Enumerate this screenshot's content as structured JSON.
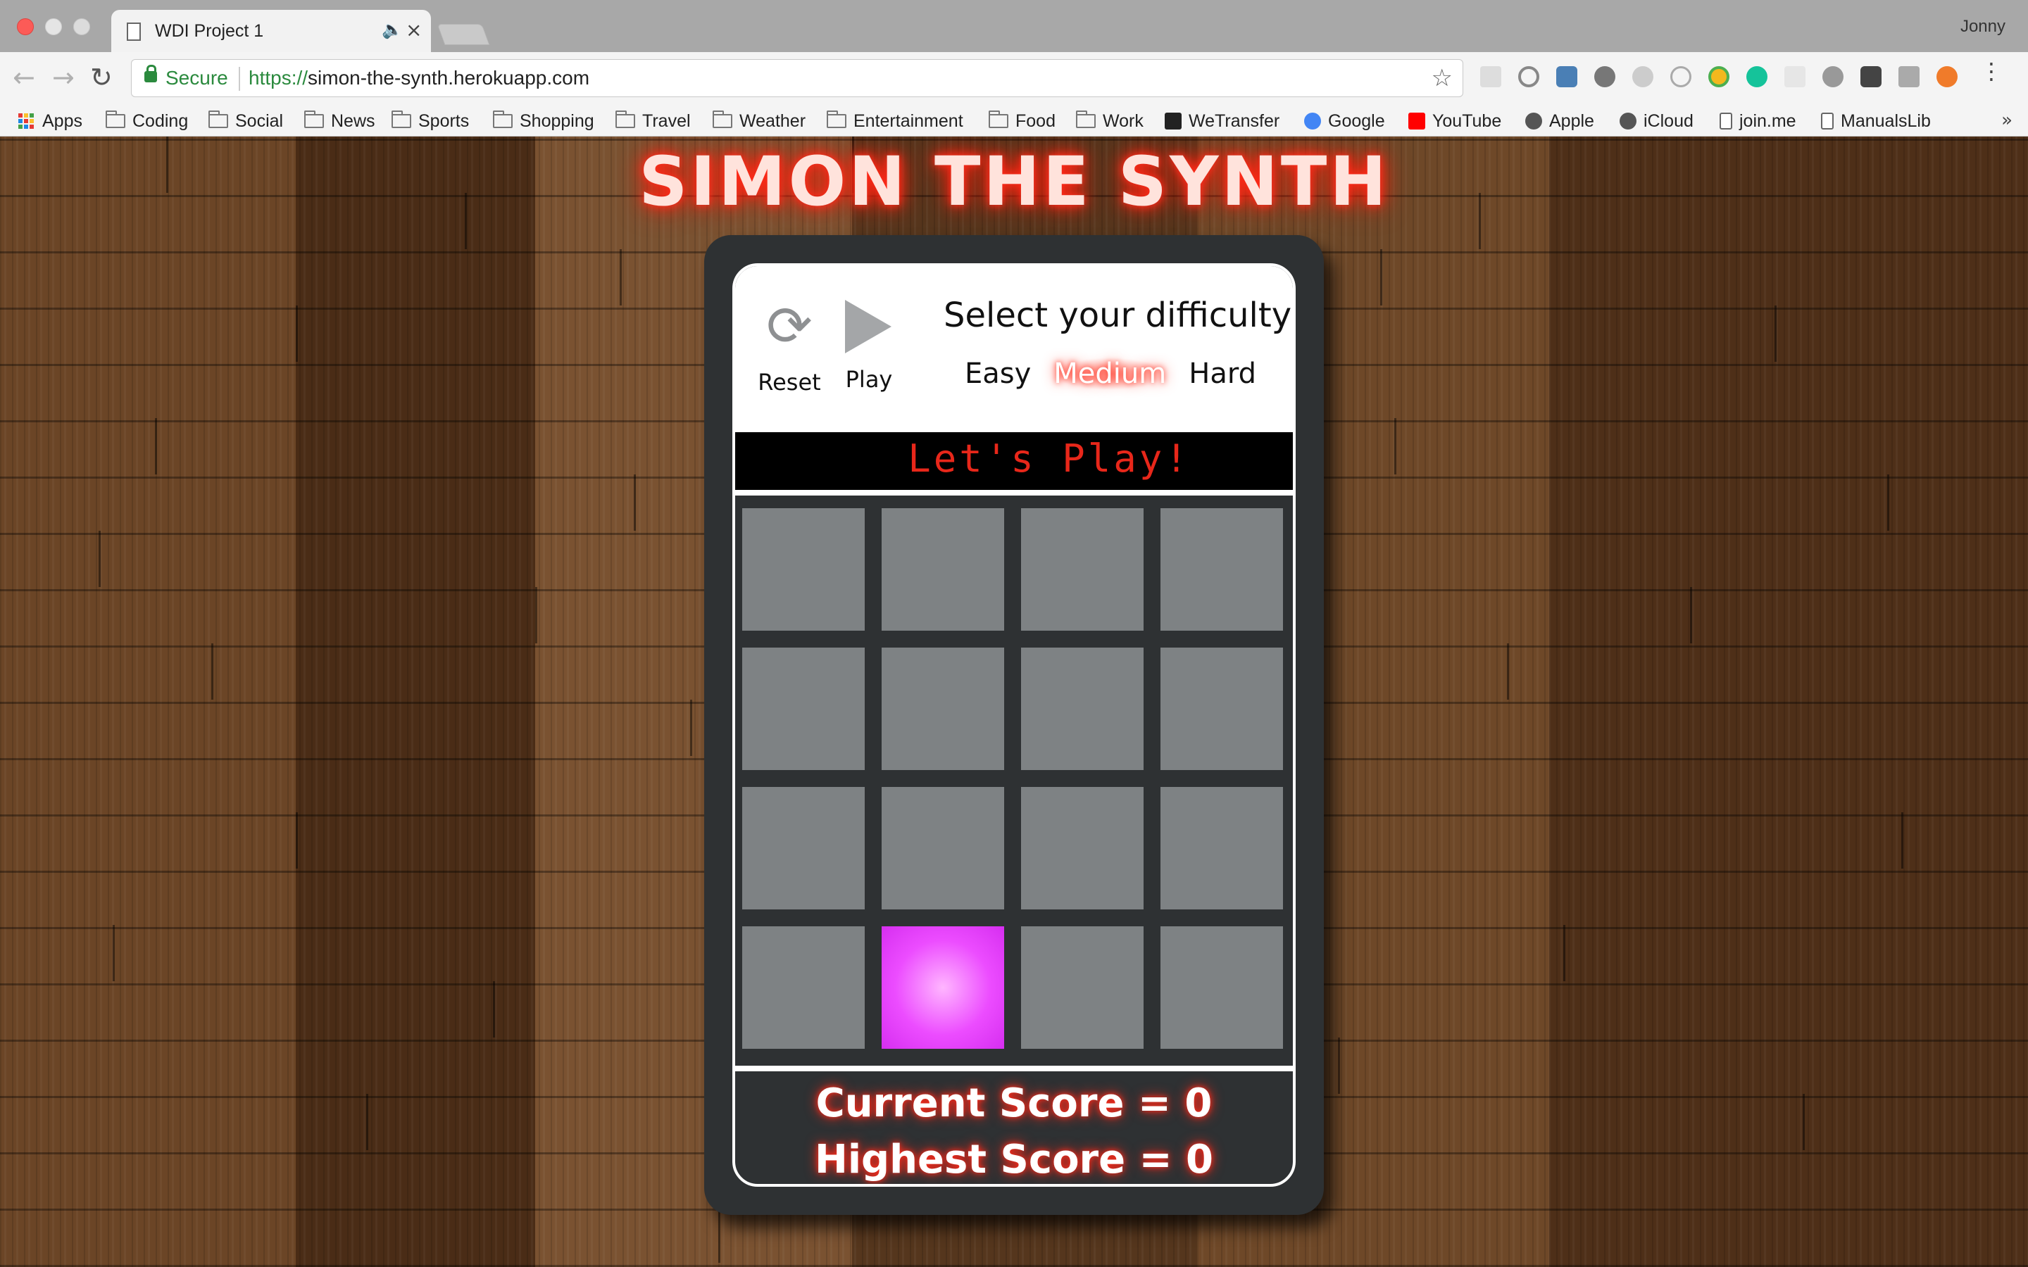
{
  "browser": {
    "tab_title": "WDI Project 1",
    "tab_audio_icon": "speaker-icon",
    "tab_close": "×",
    "user_name": "Jonny",
    "security_label": "Secure",
    "url_scheme": "https://",
    "url_host": "simon-the-synth.herokuapp.com",
    "bookmarks": [
      {
        "label": "Apps",
        "icon": "apps-grid-icon"
      },
      {
        "label": "Coding",
        "icon": "folder-icon"
      },
      {
        "label": "Social",
        "icon": "folder-icon"
      },
      {
        "label": "News",
        "icon": "folder-icon"
      },
      {
        "label": "Sports",
        "icon": "folder-icon"
      },
      {
        "label": "Shopping",
        "icon": "folder-icon"
      },
      {
        "label": "Travel",
        "icon": "folder-icon"
      },
      {
        "label": "Weather",
        "icon": "folder-icon"
      },
      {
        "label": "Entertainment",
        "icon": "folder-icon"
      },
      {
        "label": "Food",
        "icon": "folder-icon"
      },
      {
        "label": "Work",
        "icon": "folder-icon"
      },
      {
        "label": "WeTransfer",
        "icon": "wetransfer-icon"
      },
      {
        "label": "Google",
        "icon": "google-icon"
      },
      {
        "label": "YouTube",
        "icon": "youtube-icon"
      },
      {
        "label": "Apple",
        "icon": "apple-icon"
      },
      {
        "label": "iCloud",
        "icon": "apple-icon"
      },
      {
        "label": "join.me",
        "icon": "page-icon"
      },
      {
        "label": "ManualsLib",
        "icon": "page-icon"
      }
    ]
  },
  "app": {
    "title": "SIMON THE SYNTH",
    "controls": {
      "reset_label": "Reset",
      "play_label": "Play",
      "difficulty_heading": "Select your difficulty",
      "difficulty_options": [
        "Easy",
        "Medium",
        "Hard"
      ],
      "selected_difficulty": "Medium"
    },
    "display_text": "Let's Play!",
    "grid": {
      "rows": 4,
      "cols": 4,
      "lit_pad": {
        "row": 4,
        "col": 2
      },
      "pad_color": "#7e8284",
      "lit_color": "#ec4cff"
    },
    "scores": {
      "current": "Current Score = 0",
      "highest": "Highest Score = 0"
    },
    "colors": {
      "neon_red": "#ff2a1a",
      "device": "#2e3133"
    }
  }
}
